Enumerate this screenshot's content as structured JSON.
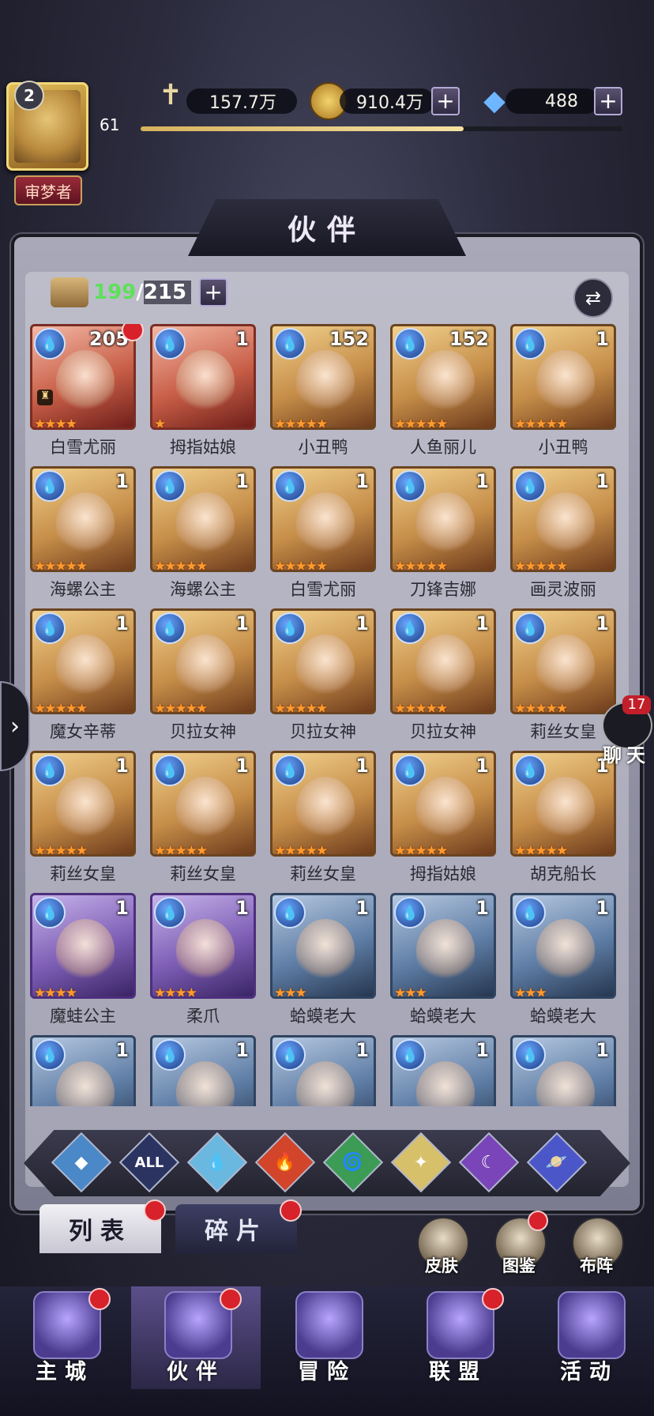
{
  "player": {
    "level_badge": "2",
    "level": "61",
    "rank": "审梦者",
    "exp_fraction": 0.67
  },
  "resources": {
    "power": "157.7万",
    "gold": "910.4万",
    "diamonds": "488"
  },
  "panel": {
    "title": "伙伴",
    "owned": "199",
    "separator": "/",
    "capacity": "215"
  },
  "heroes": [
    {
      "name": "白雪尤丽",
      "qty": "205",
      "stars": 4,
      "frame": "red",
      "dot": true,
      "lock": true
    },
    {
      "name": "拇指姑娘",
      "qty": "1",
      "stars": 1,
      "frame": "red",
      "dot": false
    },
    {
      "name": "小丑鸭",
      "qty": "152",
      "stars": 5,
      "frame": "gold",
      "dot": false
    },
    {
      "name": "人鱼丽儿",
      "qty": "152",
      "stars": 5,
      "frame": "gold",
      "dot": false
    },
    {
      "name": "小丑鸭",
      "qty": "1",
      "stars": 5,
      "frame": "gold",
      "dot": false
    },
    {
      "name": "海螺公主",
      "qty": "1",
      "stars": 5,
      "frame": "gold",
      "dot": false
    },
    {
      "name": "海螺公主",
      "qty": "1",
      "stars": 5,
      "frame": "gold",
      "dot": false
    },
    {
      "name": "白雪尤丽",
      "qty": "1",
      "stars": 5,
      "frame": "gold",
      "dot": false
    },
    {
      "name": "刀锋吉娜",
      "qty": "1",
      "stars": 5,
      "frame": "gold",
      "dot": false
    },
    {
      "name": "画灵波丽",
      "qty": "1",
      "stars": 5,
      "frame": "gold",
      "dot": false
    },
    {
      "name": "魔女辛蒂",
      "qty": "1",
      "stars": 5,
      "frame": "gold",
      "dot": false
    },
    {
      "name": "贝拉女神",
      "qty": "1",
      "stars": 5,
      "frame": "gold",
      "dot": false
    },
    {
      "name": "贝拉女神",
      "qty": "1",
      "stars": 5,
      "frame": "gold",
      "dot": false
    },
    {
      "name": "贝拉女神",
      "qty": "1",
      "stars": 5,
      "frame": "gold",
      "dot": false
    },
    {
      "name": "莉丝女皇",
      "qty": "1",
      "stars": 5,
      "frame": "gold",
      "dot": false
    },
    {
      "name": "莉丝女皇",
      "qty": "1",
      "stars": 5,
      "frame": "gold",
      "dot": false
    },
    {
      "name": "莉丝女皇",
      "qty": "1",
      "stars": 5,
      "frame": "gold",
      "dot": false
    },
    {
      "name": "莉丝女皇",
      "qty": "1",
      "stars": 5,
      "frame": "gold",
      "dot": false
    },
    {
      "name": "拇指姑娘",
      "qty": "1",
      "stars": 5,
      "frame": "gold",
      "dot": false
    },
    {
      "name": "胡克船长",
      "qty": "1",
      "stars": 5,
      "frame": "gold",
      "dot": false
    },
    {
      "name": "魔蛙公主",
      "qty": "1",
      "stars": 4,
      "frame": "purple",
      "dot": false
    },
    {
      "name": "柔爪",
      "qty": "1",
      "stars": 4,
      "frame": "purple",
      "dot": false
    },
    {
      "name": "蛤蟆老大",
      "qty": "1",
      "stars": 3,
      "frame": "blue",
      "dot": false
    },
    {
      "name": "蛤蟆老大",
      "qty": "1",
      "stars": 3,
      "frame": "blue",
      "dot": false
    },
    {
      "name": "蛤蟆老大",
      "qty": "1",
      "stars": 3,
      "frame": "blue",
      "dot": false
    },
    {
      "name": "",
      "qty": "1",
      "stars": 0,
      "frame": "blue",
      "dot": false
    },
    {
      "name": "",
      "qty": "1",
      "stars": 0,
      "frame": "blue",
      "dot": false
    },
    {
      "name": "",
      "qty": "1",
      "stars": 0,
      "frame": "blue",
      "dot": false
    },
    {
      "name": "",
      "qty": "1",
      "stars": 0,
      "frame": "blue",
      "dot": false
    },
    {
      "name": "",
      "qty": "1",
      "stars": 0,
      "frame": "blue",
      "dot": false
    }
  ],
  "filters": [
    {
      "icon": "all-factions-icon",
      "glyph": "◆",
      "color": "#4a88c8"
    },
    {
      "icon": "all-label-icon",
      "glyph": "ALL",
      "color": "#2b3460"
    },
    {
      "icon": "water-element-icon",
      "glyph": "💧",
      "color": "#6ab8e0"
    },
    {
      "icon": "fire-element-icon",
      "glyph": "🔥",
      "color": "#d2452b"
    },
    {
      "icon": "wind-element-icon",
      "glyph": "🌀",
      "color": "#3c9b54"
    },
    {
      "icon": "light-element-icon",
      "glyph": "✦",
      "color": "#d7c06a"
    },
    {
      "icon": "dark-element-icon",
      "glyph": "☾",
      "color": "#7a45b8"
    },
    {
      "icon": "cosmic-element-icon",
      "glyph": "🪐",
      "color": "#4b57c8"
    }
  ],
  "tabs": {
    "list": "列表",
    "shards": "碎片"
  },
  "shortcuts": {
    "skins": "皮肤",
    "codex": "图鉴",
    "formation": "布阵"
  },
  "chat": {
    "count": "17",
    "label": "聊天"
  },
  "nav": [
    {
      "label": "主城",
      "dot": true,
      "active": false
    },
    {
      "label": "伙伴",
      "dot": true,
      "active": true
    },
    {
      "label": "冒险",
      "dot": false,
      "active": false
    },
    {
      "label": "联盟",
      "dot": true,
      "active": false
    },
    {
      "label": "活动",
      "dot": false,
      "active": false
    }
  ],
  "colors": {
    "accent_green": "#5ee05a",
    "star_orange": "#ff9a2e",
    "notify_red": "#d7212b"
  }
}
